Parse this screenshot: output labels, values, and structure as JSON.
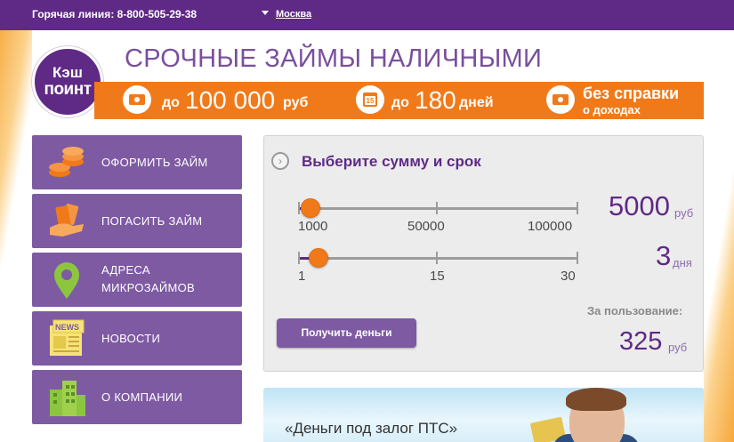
{
  "header": {
    "hotline": "Горячая линия: 8-800-505-29-38",
    "city": "Москва"
  },
  "logo": {
    "line1": "Кэш",
    "line2": "поинт"
  },
  "headline": "СРОЧНЫЕ ЗАЙМЫ НАЛИЧНЫМИ",
  "promo": {
    "amount": {
      "prefix": "до",
      "value": "100 000",
      "unit": "руб",
      "icon": "money-icon"
    },
    "term": {
      "prefix": "до",
      "value": "180",
      "unit": "дней",
      "icon": "calendar-icon",
      "icon_text": "15"
    },
    "noref": {
      "line1": "без справки",
      "line2": "о доходах",
      "icon": "money-icon"
    }
  },
  "nav": [
    {
      "label": "ОФОРМИТЬ ЗАЙМ",
      "icon": "coins-icon"
    },
    {
      "label": "ПОГАСИТЬ ЗАЙМ",
      "icon": "hand-money-icon"
    },
    {
      "label": "АДРЕСА\nМИКРОЗАЙМОВ",
      "icon": "map-pin-icon"
    },
    {
      "label": "НОВОСТИ",
      "icon": "newspaper-icon",
      "badge": "NEWS"
    },
    {
      "label": "О КОМПАНИИ",
      "icon": "building-icon"
    }
  ],
  "calculator": {
    "title": "Выберите сумму и срок",
    "arrow": "›",
    "amount_slider": {
      "min": 1000,
      "max": 100000,
      "value": 5000,
      "labels": [
        "1000",
        "50000",
        "100000"
      ],
      "display": "5000",
      "unit": "руб"
    },
    "term_slider": {
      "min": 1,
      "max": 30,
      "value": 3,
      "labels": [
        "1",
        "15",
        "30"
      ],
      "display": "3",
      "unit": "дня"
    },
    "use_label": "За пользование:",
    "total": "325",
    "total_unit": "руб",
    "button": "Получить деньги"
  },
  "banner": {
    "text": "«Деньги под залог ПТС»"
  },
  "colors": {
    "brand": "#5f2a86",
    "accent": "#f07a1a",
    "nav": "#7e5aa3"
  }
}
